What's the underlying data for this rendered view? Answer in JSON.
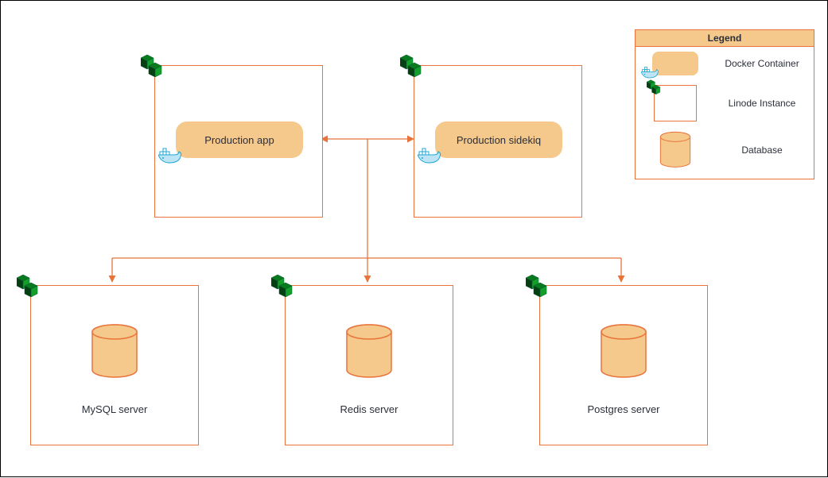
{
  "legend": {
    "title": "Legend",
    "items": [
      {
        "label": "Docker Container"
      },
      {
        "label": "Linode Instance"
      },
      {
        "label": "Database"
      }
    ]
  },
  "top_nodes": [
    {
      "label": "Production app"
    },
    {
      "label": "Production sidekiq"
    }
  ],
  "db_nodes": [
    {
      "label": "MySQL server"
    },
    {
      "label": "Redis server"
    },
    {
      "label": "Postgres server"
    }
  ]
}
